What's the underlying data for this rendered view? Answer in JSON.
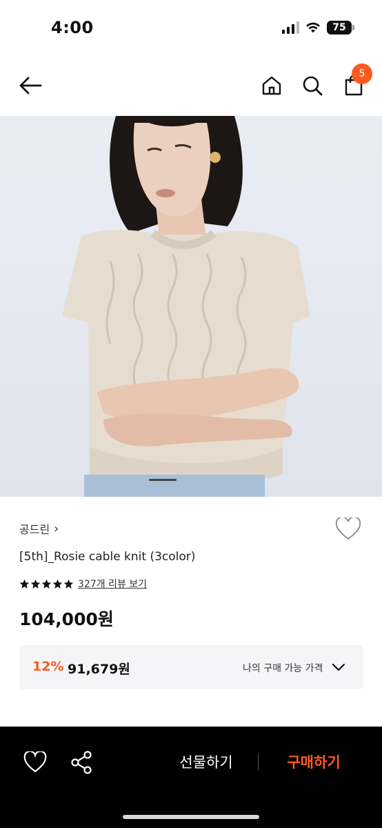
{
  "status_bar": {
    "time": "4:00",
    "battery": "75"
  },
  "header": {
    "cart_count": "5",
    "icons": [
      "back-arrow-icon",
      "home-icon",
      "search-icon",
      "cart-icon"
    ]
  },
  "product": {
    "brand": "공드린",
    "brand_chevron": "›",
    "name": "[5th]_Rosie cable knit (3color)",
    "rating_stars": 5,
    "review_link": "327개 리뷰 보기",
    "price": "104,000원",
    "discount": {
      "rate": "12%",
      "price": "91,679원",
      "label": "나의 구매 가능 가격"
    }
  },
  "bottom_bar": {
    "gift_label": "선물하기",
    "buy_label": "구매하기"
  },
  "colors": {
    "accent": "#ff5a1f",
    "bottom_bar_bg": "#000000",
    "discount_box_bg": "#f5f5f7"
  }
}
